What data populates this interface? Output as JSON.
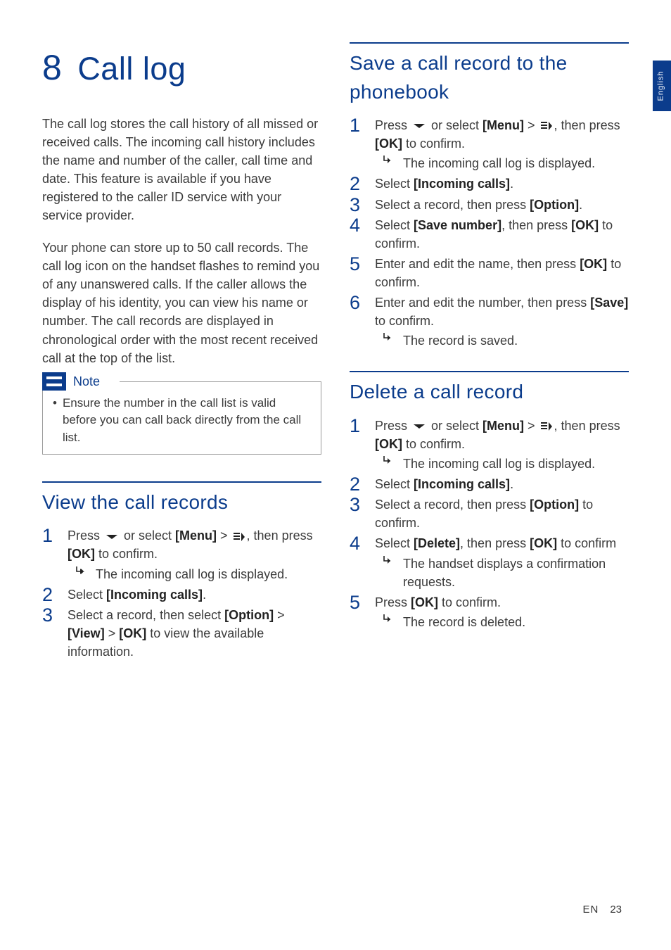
{
  "language_tab": "English",
  "footer": {
    "lang": "EN",
    "page": "23"
  },
  "chapter": {
    "number": "8",
    "title": "Call log"
  },
  "intro": {
    "p1": "The call log stores the call history of all missed or received calls. The incoming call history includes the name and number of the caller, call time and date. This feature is available if you have registered to the caller ID service with your service provider.",
    "p2": "Your phone can store up to 50 call records. The call log icon on the handset flashes to remind you of any unanswered calls. If the caller allows the display of his identity, you can view his name or number. The call records are displayed in chronological order with the most recent received call at the top of the list."
  },
  "note": {
    "label": "Note",
    "body": "Ensure the number in the call list is valid before you can call back directly from the call list."
  },
  "sections": {
    "view": {
      "title": "View the call records",
      "steps": [
        {
          "pre": "Press ",
          "mid": " or select ",
          "menu": "[Menu]",
          "gt": " > ",
          "post1": ", then press ",
          "ok": "[OK]",
          "post2": " to confirm.",
          "result": "The incoming call log is displayed."
        },
        {
          "text_a": "Select ",
          "bold": "[Incoming calls]",
          "text_b": "."
        },
        {
          "text_a": "Select a record, then select ",
          "b1": "[Option]",
          "gt1": " > ",
          "b2": "[View]",
          "gt2": " > ",
          "b3": "[OK]",
          "text_b": " to view the available information."
        }
      ]
    },
    "save": {
      "title": "Save a call record to the phonebook",
      "steps": [
        {
          "pre": "Press ",
          "mid": " or select ",
          "menu": "[Menu]",
          "gt": " > ",
          "post1": ", then press ",
          "ok": "[OK]",
          "post2": " to confirm.",
          "result": "The incoming call log is displayed."
        },
        {
          "text_a": "Select ",
          "bold": "[Incoming calls]",
          "text_b": "."
        },
        {
          "text_a": "Select a record, then press ",
          "bold": "[Option]",
          "text_b": "."
        },
        {
          "text_a": "Select ",
          "b1": "[Save number]",
          "mid": ", then press ",
          "b2": "[OK]",
          "text_b": " to confirm."
        },
        {
          "text_a": "Enter and edit the name, then press ",
          "bold": "[OK]",
          "text_b": " to confirm."
        },
        {
          "text_a": "Enter and edit the number, then press ",
          "bold": "[Save]",
          "text_b": " to confirm.",
          "result": "The record is saved."
        }
      ]
    },
    "delete": {
      "title": "Delete a call record",
      "steps": [
        {
          "pre": "Press ",
          "mid": " or select ",
          "menu": "[Menu]",
          "gt": " > ",
          "post1": ", then press ",
          "ok": "[OK]",
          "post2": " to confirm.",
          "result": "The incoming call log is displayed."
        },
        {
          "text_a": "Select ",
          "bold": "[Incoming calls]",
          "text_b": "."
        },
        {
          "text_a": "Select a record, then press ",
          "bold": "[Option]",
          "text_b": " to confirm."
        },
        {
          "text_a": "Select ",
          "b1": "[Delete]",
          "mid": ", then press ",
          "b2": "[OK]",
          "text_b": " to confirm",
          "result": "The handset displays a confirmation requests."
        },
        {
          "text_a": "Press ",
          "bold": "[OK]",
          "text_b": " to confirm.",
          "result": "The record is deleted."
        }
      ]
    }
  }
}
